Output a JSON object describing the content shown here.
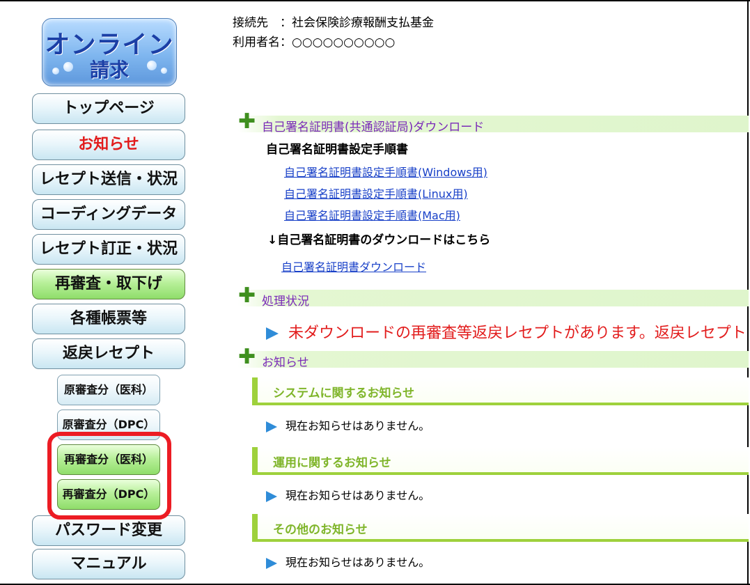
{
  "logo": {
    "line1": "オンライン",
    "line2": "請求"
  },
  "nav": [
    "トップページ",
    "お知らせ",
    "レセプト送信・状況",
    "コーディングデータ",
    "レセプト訂正・状況",
    "再審査・取下げ",
    "各種帳票等",
    "返戻レセプト",
    "パスワード変更",
    "マニュアル"
  ],
  "subnav": [
    "原審査分（医科）",
    "原審査分（DPC）",
    "再審査分（医科）",
    "再審査分（DPC）"
  ],
  "header": {
    "connection": "接続先　：社会保険診療報酬支払基金",
    "user": "利用者名：○○○○○○○○○○"
  },
  "cert_section": {
    "title": "自己署名証明書(共通認証局)ダウンロード",
    "manual_heading": "自己署名証明書設定手順書",
    "links": [
      "自己署名証明書設定手順書(Windows用)",
      "自己署名証明書設定手順書(Linux用)",
      "自己署名証明書設定手順書(Mac用)"
    ],
    "download_heading": "↓自己署名証明書のダウンロードはこちら",
    "download_link": "自己署名証明書ダウンロード"
  },
  "status_section": {
    "title": "処理状況",
    "message": "未ダウンロードの再審査等返戻レセプトがあります。返戻レセプト"
  },
  "notice_section": {
    "title": "お知らせ",
    "groups": [
      {
        "title": "システムに関するお知らせ",
        "message": "現在お知らせはありません。"
      },
      {
        "title": "運用に関するお知らせ",
        "message": "現在お知らせはありません。"
      },
      {
        "title": "その他のお知らせ",
        "message": "現在お知らせはありません。"
      }
    ]
  },
  "colors": {
    "accent_red": "#e21c1c",
    "link_blue": "#1840c8",
    "section_green": "#3f8f1f",
    "notice_green": "#9ed13c"
  }
}
